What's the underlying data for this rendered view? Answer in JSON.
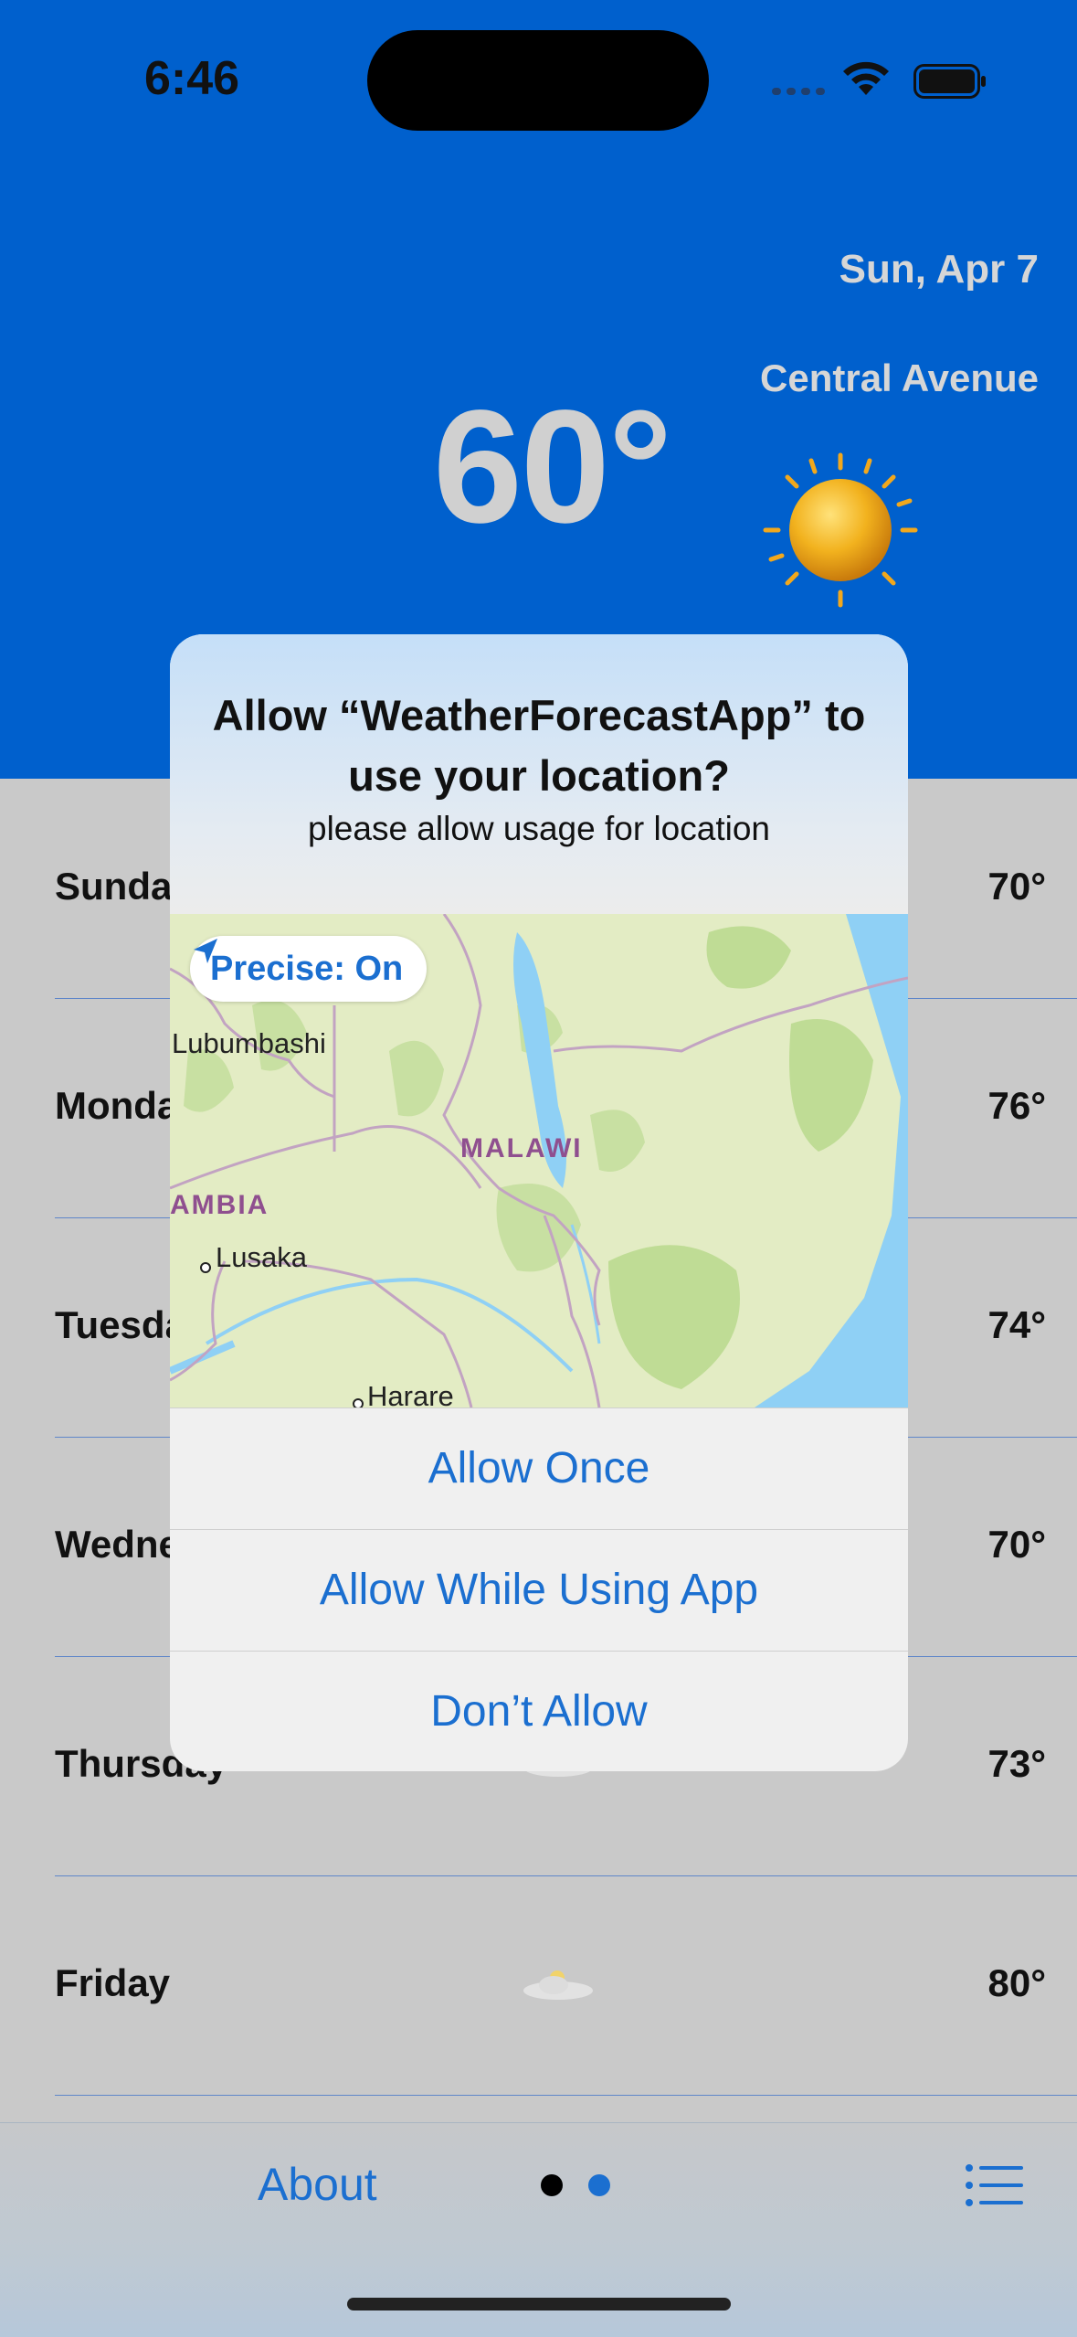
{
  "status_bar": {
    "time": "6:46"
  },
  "header": {
    "date": "Sun, Apr 7",
    "location": "Central Avenue",
    "temperature": "60°",
    "condition_icon": "sun-icon"
  },
  "forecast": [
    {
      "day": "Sunday",
      "high": "70°",
      "icon": "cloud-icon"
    },
    {
      "day": "Monday",
      "high": "76°",
      "icon": "cloud-icon"
    },
    {
      "day": "Tuesday",
      "high": "74°",
      "icon": "cloud-icon"
    },
    {
      "day": "Wednesday",
      "high": "70°",
      "icon": "cloud-icon"
    },
    {
      "day": "Thursday",
      "high": "73°",
      "icon": "cloud-icon"
    },
    {
      "day": "Friday",
      "high": "80°",
      "icon": "cloud-icon"
    }
  ],
  "tab_bar": {
    "about_label": "About",
    "page_count": 2,
    "current_page": 1,
    "list_icon": "list-icon"
  },
  "dialog": {
    "title": "Allow “WeatherForecastApp” to use your location?",
    "message": "please allow usage for location",
    "precise_label": "Precise: On",
    "map_labels": {
      "city_lubumbashi": "Lubumbashi",
      "country_malawi": "MALAWI",
      "country_zambia": "AMBIA",
      "city_lusaka": "Lusaka",
      "city_harare": "Harare"
    },
    "buttons": {
      "allow_once": "Allow Once",
      "allow_while_using": "Allow While Using App",
      "dont_allow": "Don’t Allow"
    }
  },
  "colors": {
    "header_blue": "#0060cd",
    "accent_blue": "#1b6fd0",
    "background_gray": "#c9c9c9"
  }
}
